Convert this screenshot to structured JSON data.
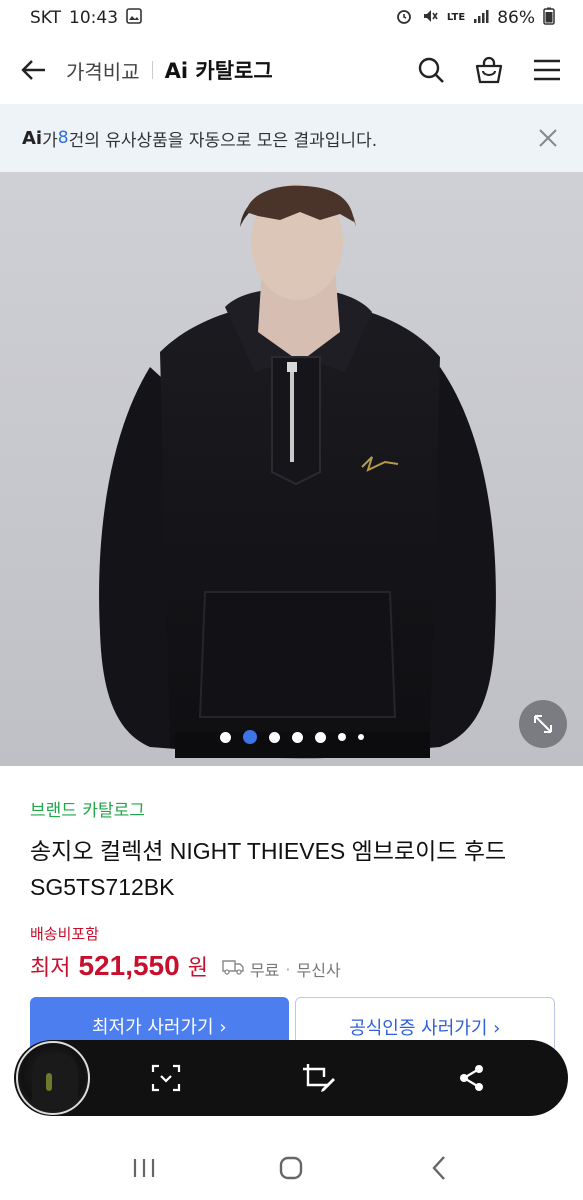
{
  "status_bar": {
    "carrier": "SKT",
    "time": "10:43",
    "battery": "86%",
    "icons": [
      "gallery-icon",
      "alarm-icon",
      "mute-icon",
      "lte-icon",
      "signal-icon",
      "battery-icon"
    ],
    "lte_label": "LTE"
  },
  "header": {
    "sub_title": "가격비교",
    "title": "Ai 카탈로그",
    "icons": [
      "back-arrow-icon",
      "search-icon",
      "shopping-bag-icon",
      "menu-icon"
    ]
  },
  "ai_banner": {
    "logo": "Ai",
    "text_before": "가 ",
    "count": "8",
    "text_after": "건의 유사상품을 자동으로 모은 결과입니다.",
    "icons": [
      "close-icon"
    ]
  },
  "hero": {
    "carousel": {
      "total_pages": 7,
      "current_page": 2
    },
    "icons": [
      "expand-icon"
    ]
  },
  "product": {
    "brand_label": "브랜드 카탈로그",
    "title": "송지오 컬렉션 NIGHT THIEVES 엠브로이드 후드 SG5TS712BK",
    "shipping_included": "배송비포함",
    "price_prefix": "최저",
    "price": "521,550",
    "price_unit": "원",
    "shipping": "무료",
    "shop": "무신사",
    "icons": [
      "truck-icon"
    ]
  },
  "actions": {
    "lowest_price_btn": "최저가 사러가기 ›",
    "official_btn": "공식인증 사러가기 ›"
  },
  "floating_bar": {
    "icons": [
      "scan-icon",
      "crop-edit-icon",
      "share-icon"
    ]
  },
  "nav_bar": {
    "icons": [
      "recent-apps-icon",
      "home-icon",
      "back-icon"
    ]
  },
  "colors": {
    "accent_blue": "#4c7ef0",
    "price_red": "#c8102e",
    "brand_green": "#20a748",
    "banner_bg": "#eef3f8"
  }
}
